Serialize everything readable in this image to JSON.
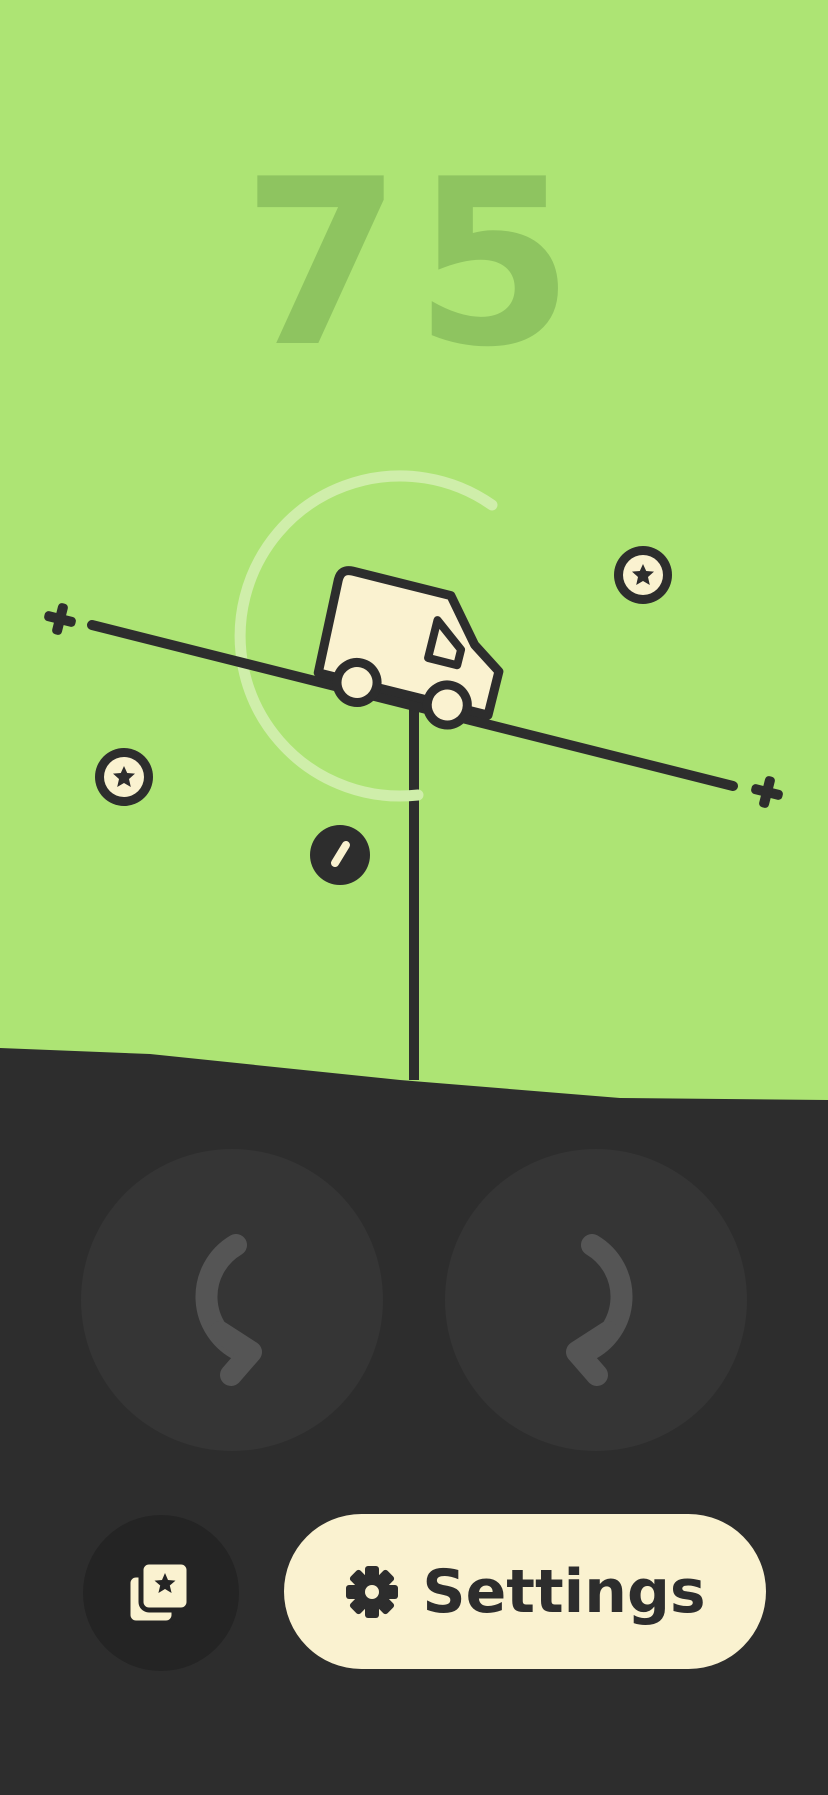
{
  "game": {
    "score": "75",
    "level_fraction": 0.55
  },
  "controls": {
    "rotate_left_icon": "rotate-counterclockwise-arrow",
    "rotate_right_icon": "rotate-clockwise-arrow"
  },
  "bottom_bar": {
    "gallery_icon": "cards-star-icon",
    "settings_icon": "gear-icon",
    "settings_label": "Settings"
  },
  "colors": {
    "sky": "#ade474",
    "ground": "#2d2d2d",
    "score": "#8ec460",
    "cream": "#faf2d0",
    "ink": "#2d2d2d"
  }
}
